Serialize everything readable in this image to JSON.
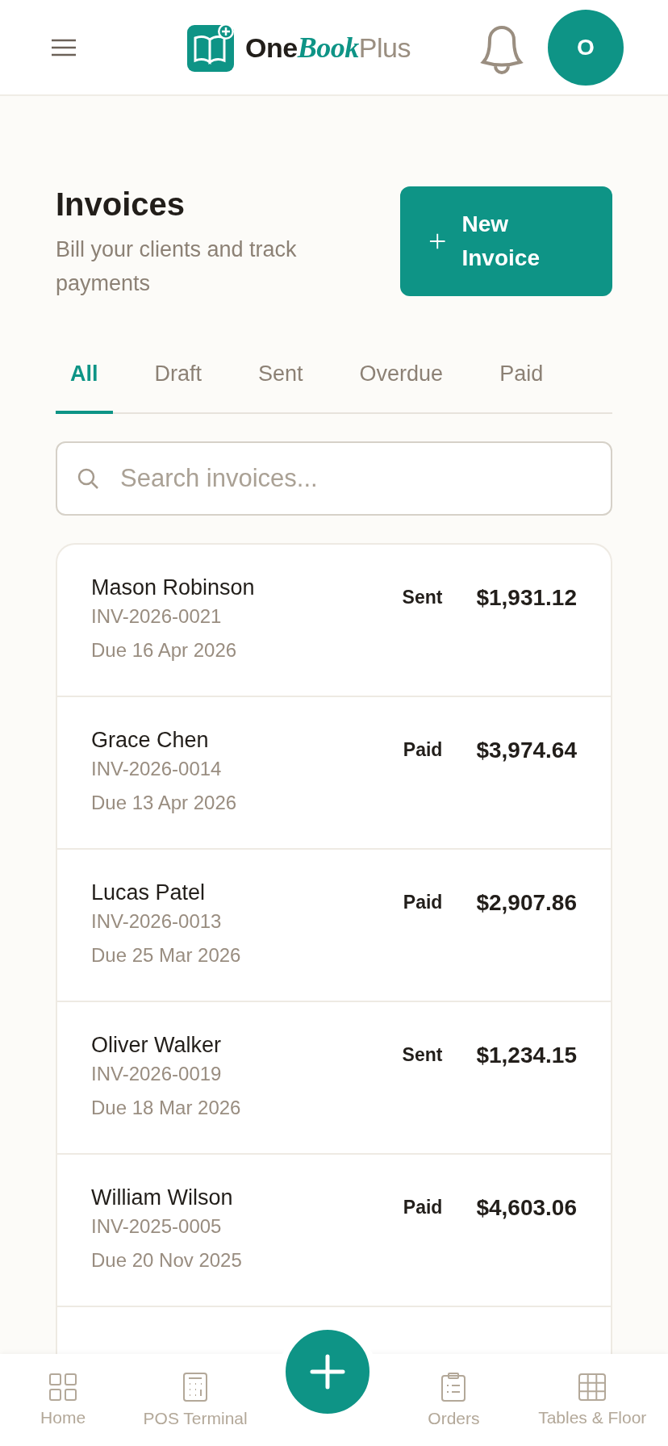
{
  "header": {
    "logo": {
      "part_1": "One",
      "part_2": "Book",
      "part_3": "Plus"
    },
    "avatar": "O"
  },
  "page": {
    "title": "Invoices",
    "subtitle": "Bill your clients and track payments",
    "new_button": "New Invoice"
  },
  "tabs": [
    {
      "label": "All",
      "selected": true
    },
    {
      "label": "Draft",
      "selected": false
    },
    {
      "label": "Sent",
      "selected": false
    },
    {
      "label": "Overdue",
      "selected": false
    },
    {
      "label": "Paid",
      "selected": false
    }
  ],
  "search": {
    "placeholder": "Search invoices..."
  },
  "invoices": [
    {
      "client": "Mason Robinson",
      "number": "INV-2026-0021",
      "due": "Due 16 Apr 2026",
      "status": "Sent",
      "amount": "$1,931.12"
    },
    {
      "client": "Grace Chen",
      "number": "INV-2026-0014",
      "due": "Due 13 Apr 2026",
      "status": "Paid",
      "amount": "$3,974.64"
    },
    {
      "client": "Lucas Patel",
      "number": "INV-2026-0013",
      "due": "Due 25 Mar 2026",
      "status": "Paid",
      "amount": "$2,907.86"
    },
    {
      "client": "Oliver Walker",
      "number": "INV-2026-0019",
      "due": "Due 18 Mar 2026",
      "status": "Sent",
      "amount": "$1,234.15"
    },
    {
      "client": "William Wilson",
      "number": "INV-2025-0005",
      "due": "Due 20 Nov 2025",
      "status": "Paid",
      "amount": "$4,603.06"
    }
  ],
  "bottom_nav": [
    {
      "kind": "home",
      "label": "Home"
    },
    {
      "kind": "pos",
      "label": "POS Terminal"
    },
    {
      "kind": "add"
    },
    {
      "kind": "orders",
      "label": "Orders"
    },
    {
      "kind": "tables",
      "label": "Tables & Floor"
    }
  ]
}
